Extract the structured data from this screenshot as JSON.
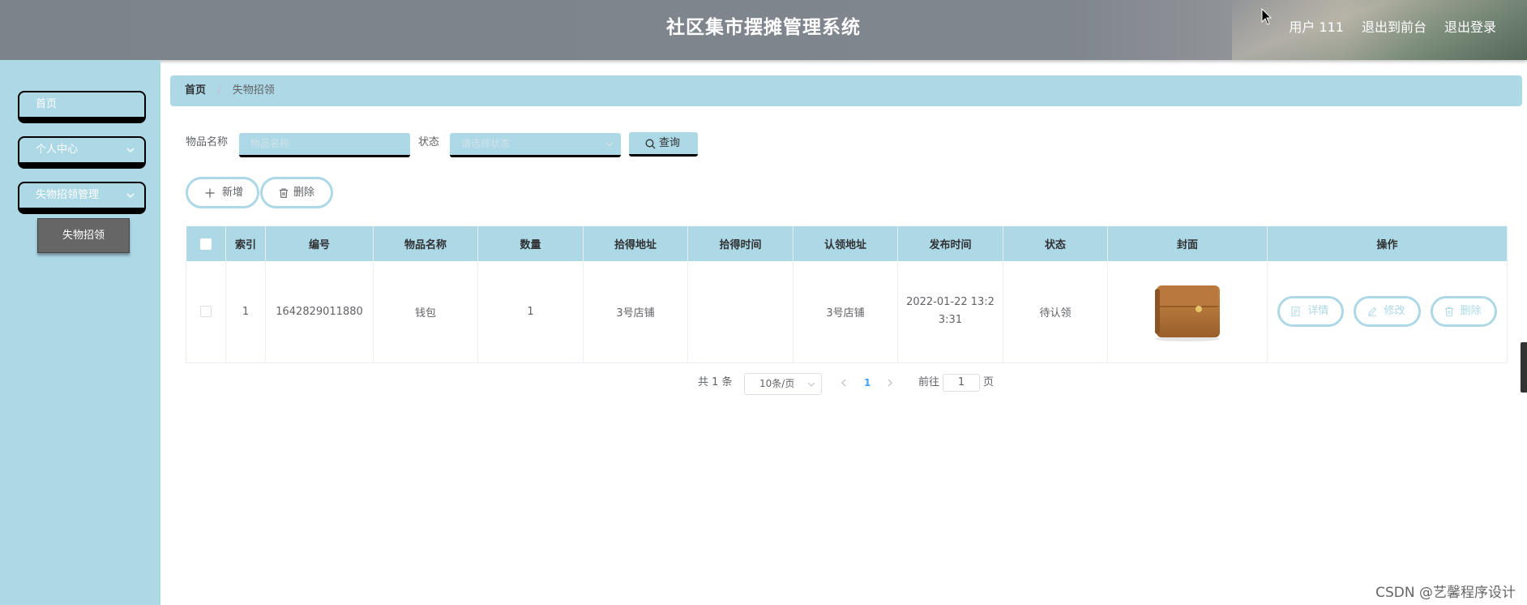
{
  "header": {
    "title": "社区集市摆摊管理系统",
    "user": "用户 111",
    "to_front": "退出到前台",
    "logout": "退出登录"
  },
  "sidebar": {
    "items": [
      {
        "label": "首页"
      },
      {
        "label": "个人中心"
      },
      {
        "label": "失物招领管理"
      }
    ],
    "sub_item": "失物招领"
  },
  "breadcrumb": {
    "home": "首页",
    "separator": "/",
    "current": "失物招领"
  },
  "search": {
    "name_label": "物品名称",
    "name_placeholder": "物品名称",
    "status_label": "状态",
    "status_placeholder": "请选择状态",
    "query_label": "查询"
  },
  "actions": {
    "add": "新增",
    "delete": "删除"
  },
  "table": {
    "columns": [
      "索引",
      "编号",
      "物品名称",
      "数量",
      "拾得地址",
      "拾得时间",
      "认领地址",
      "发布时间",
      "状态",
      "封面",
      "操作"
    ],
    "rows": [
      {
        "index": "1",
        "number": "1642829011880",
        "name": "钱包",
        "quantity": "1",
        "found_address": "3号店铺",
        "found_time": "",
        "claim_address": "3号店铺",
        "publish_time_line1": "2022-01-22 13:2",
        "publish_time_line2": "3:31",
        "status": "待认领",
        "ops": {
          "detail": "详情",
          "edit": "修改",
          "delete": "删除"
        }
      }
    ]
  },
  "pagination": {
    "total": "共 1 条",
    "page_size": "10条/页",
    "current_page": "1",
    "goto_label": "前往",
    "goto_value": "1",
    "page_unit": "页"
  },
  "watermark": "CSDN @艺馨程序设计",
  "colors": {
    "accent": "#add8e6",
    "sidebar_sub": "#666666",
    "header": "#80868e",
    "active_page": "#409eff"
  }
}
